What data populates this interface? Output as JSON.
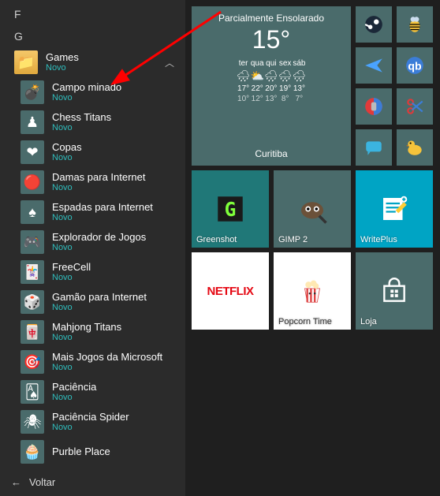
{
  "letters": {
    "f": "F",
    "g": "G"
  },
  "folder": {
    "name": "Games",
    "sub": "Novo"
  },
  "items": [
    {
      "name": "Campo minado",
      "sub": "Novo",
      "emoji": "💣"
    },
    {
      "name": "Chess Titans",
      "sub": "Novo",
      "emoji": "♟"
    },
    {
      "name": "Copas",
      "sub": "Novo",
      "emoji": "❤"
    },
    {
      "name": "Damas para Internet",
      "sub": "Novo",
      "emoji": "🔴"
    },
    {
      "name": "Espadas para Internet",
      "sub": "Novo",
      "emoji": "♠"
    },
    {
      "name": "Explorador de Jogos",
      "sub": "Novo",
      "emoji": "🎮"
    },
    {
      "name": "FreeCell",
      "sub": "Novo",
      "emoji": "🃏"
    },
    {
      "name": "Gamão para Internet",
      "sub": "Novo",
      "emoji": "🎲"
    },
    {
      "name": "Mahjong Titans",
      "sub": "Novo",
      "emoji": "🀄"
    },
    {
      "name": "Mais Jogos da Microsoft",
      "sub": "Novo",
      "emoji": "🎯"
    },
    {
      "name": "Paciência",
      "sub": "Novo",
      "emoji": "🂡"
    },
    {
      "name": "Paciência Spider",
      "sub": "Novo",
      "emoji": "🕷"
    },
    {
      "name": "Purble Place",
      "sub": "",
      "emoji": "🧁"
    }
  ],
  "back": "Voltar",
  "weather": {
    "summary": "Parcialmente Ensolarado",
    "temp": "15°",
    "city": "Curitiba",
    "days": [
      {
        "d": "ter",
        "icon": "🌧",
        "hi": "17°",
        "lo": "10°"
      },
      {
        "d": "qua",
        "icon": "⛅",
        "hi": "22°",
        "lo": "12°"
      },
      {
        "d": "qui",
        "icon": "🌧",
        "hi": "20°",
        "lo": "13°"
      },
      {
        "d": "sex",
        "icon": "🌧",
        "hi": "19°",
        "lo": "8°"
      },
      {
        "d": "sáb",
        "icon": "🌧",
        "hi": "13°",
        "lo": "7°"
      }
    ]
  },
  "tiles": {
    "greenshot": "Greenshot",
    "gimp": "GIMP 2",
    "writeplus": "WritePlus",
    "netflix": "NETFLIX",
    "popcorn": "Popcorn Time",
    "store": "Loja"
  }
}
